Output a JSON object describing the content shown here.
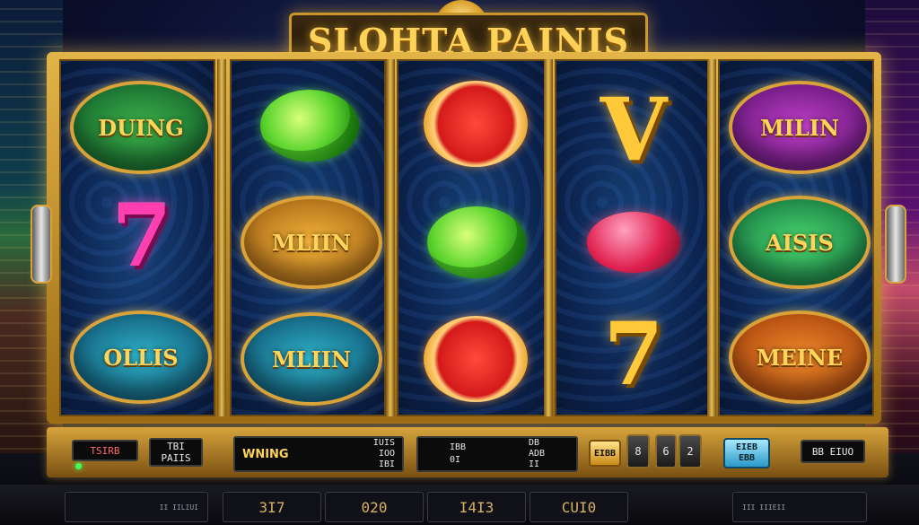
{
  "title": "SLOHTA PAINIS",
  "reels": [
    {
      "symbols": [
        {
          "kind": "badge",
          "color": "green",
          "label": "DUING"
        },
        {
          "kind": "digit",
          "color": "pink",
          "label": "7"
        },
        {
          "kind": "badge",
          "color": "teal",
          "label": "OLLIS"
        }
      ]
    },
    {
      "symbols": [
        {
          "kind": "lime",
          "label": ""
        },
        {
          "kind": "badge",
          "color": "gold",
          "label": "MLIIN"
        },
        {
          "kind": "badge",
          "color": "teal",
          "label": "MLIIN"
        }
      ]
    },
    {
      "symbols": [
        {
          "kind": "grapefruit",
          "label": ""
        },
        {
          "kind": "lime",
          "label": ""
        },
        {
          "kind": "grapefruit",
          "label": ""
        }
      ]
    },
    {
      "symbols": [
        {
          "kind": "digit",
          "color": "gold",
          "label": "V"
        },
        {
          "kind": "gem",
          "label": ""
        },
        {
          "kind": "digit",
          "color": "gold",
          "label": "7"
        }
      ]
    },
    {
      "symbols": [
        {
          "kind": "badge",
          "color": "magenta",
          "label": "MILIN"
        },
        {
          "kind": "badge",
          "color": "lime",
          "label": "AISIS"
        },
        {
          "kind": "badge",
          "color": "orange",
          "label": "MEINE"
        }
      ]
    }
  ],
  "panel": {
    "display1": "TSIRB",
    "display2_line1": "TBI",
    "display2_line2": "PAIIS",
    "winning_label": "WNING",
    "win_a": "IUIS",
    "win_b": "IOO",
    "win_c": "IBI",
    "bet_a": "IBB",
    "bet_b": "DB",
    "bet_c": "0I",
    "bet_d": "ADB",
    "bet_e": "II",
    "button_gold": "EIBB",
    "button_8": "8",
    "button_6": "6",
    "button_2": "2",
    "button_blue_line1": "EIEB",
    "button_blue_line2": "EBB",
    "credit_display": "BB EIUO"
  },
  "bottom": {
    "left_small": "II IILIUI",
    "b1": "3I7",
    "b2": "020",
    "b3": "I4I3",
    "b4": "CUI0",
    "right_small": "III IIIEII"
  },
  "colors": {
    "gold": "#e3b448",
    "reel_bg": "#0c2450",
    "led": "#3cff5a"
  }
}
